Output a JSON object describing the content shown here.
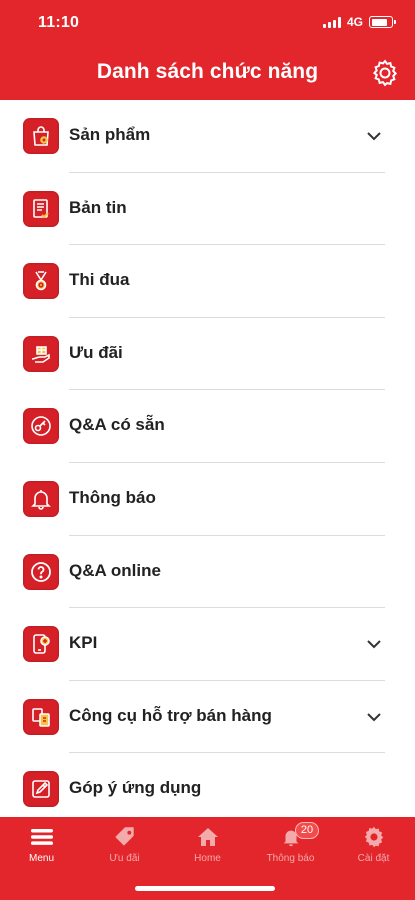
{
  "status_bar": {
    "time": "11:10",
    "network": "4G"
  },
  "header": {
    "title": "Danh sách chức năng"
  },
  "menu": {
    "items": [
      {
        "label": "Sản phẩm",
        "icon": "shopping-bag-icon",
        "expandable": true
      },
      {
        "label": "Bản tin",
        "icon": "newsletter-icon",
        "expandable": false
      },
      {
        "label": "Thi đua",
        "icon": "medal-icon",
        "expandable": false
      },
      {
        "label": "Ưu đãi",
        "icon": "gift-hand-icon",
        "expandable": false
      },
      {
        "label": "Q&A có sẵn",
        "icon": "key-circle-icon",
        "expandable": false
      },
      {
        "label": "Thông báo",
        "icon": "bell-icon",
        "expandable": false
      },
      {
        "label": "Q&A online",
        "icon": "question-circle-icon",
        "expandable": false
      },
      {
        "label": "KPI",
        "icon": "kpi-phone-icon",
        "expandable": true
      },
      {
        "label": "Công cụ hỗ trợ bán hàng",
        "icon": "sales-tools-icon",
        "expandable": true
      },
      {
        "label": "Góp ý ứng dụng",
        "icon": "pencil-feedback-icon",
        "expandable": false
      }
    ]
  },
  "tab_bar": {
    "tabs": [
      {
        "label": "Menu",
        "icon": "menu-icon",
        "active": true
      },
      {
        "label": "Ưu đãi",
        "icon": "tag-icon",
        "active": false
      },
      {
        "label": "Home",
        "icon": "home-icon",
        "active": false
      },
      {
        "label": "Thông báo",
        "icon": "bell-icon",
        "active": false,
        "badge": "20"
      },
      {
        "label": "Cài đặt",
        "icon": "gear-icon",
        "active": false
      }
    ]
  },
  "colors": {
    "brand_red": "#e2262c",
    "icon_red": "#d52027",
    "text": "#222222",
    "divider": "#dcdcdc"
  }
}
